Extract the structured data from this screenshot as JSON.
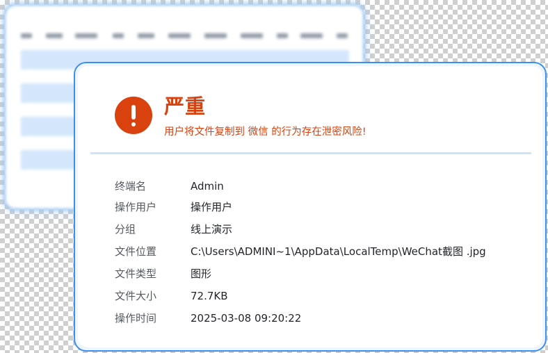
{
  "alert": {
    "severity": "严重",
    "message": "用户将文件复制到 微信 的行为存在泄密风险!",
    "icon": "exclamation-icon",
    "accent_color": "#d9410f",
    "border_color": "#3b8ff0"
  },
  "details": [
    {
      "label": "终端名",
      "value": "Admin"
    },
    {
      "label": "操作用户",
      "value": "操作用户"
    },
    {
      "label": "分组",
      "value": "线上演示"
    },
    {
      "label": "文件位置",
      "value": "C:\\Users\\ADMINI~1\\AppData\\LocalTemp\\WeChat截图 .jpg"
    },
    {
      "label": "文件类型",
      "value": "图形"
    },
    {
      "label": "文件大小",
      "value": "72.7KB"
    },
    {
      "label": "操作时间",
      "value": "2025-03-08 09:20:22"
    }
  ]
}
